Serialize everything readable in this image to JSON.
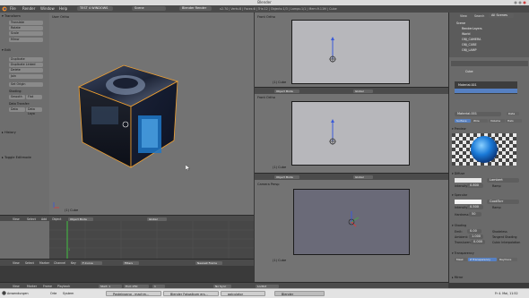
{
  "window": {
    "title": "Blender"
  },
  "info_header": {
    "menus": [
      "File",
      "Render",
      "Window",
      "Help"
    ],
    "screen_field": "TEST 4 WINDOWS",
    "scene_field": "Scene",
    "engine_field": "Blender Render",
    "stats": "v2.70 | Verts:8 | Faces:6 | Tris:12 | Objects:1/3 | Lamps:1/1 | Mem:9.11M | Cube"
  },
  "tool_panel": {
    "transform_header": "▾ Transform",
    "transform_buttons": [
      "Translate",
      "Rotate",
      "Scale",
      "Mirror"
    ],
    "edit_header": "▾ Edit",
    "edit_buttons": [
      "Duplicate",
      "Duplicate Linked",
      "Delete",
      "Join"
    ],
    "set_origin": "Set Origin",
    "shading_label": "Shading:",
    "shading_buttons": [
      "Smooth",
      "Flat"
    ],
    "data_transfer_label": "Data Transfer:",
    "data_buttons": [
      "Data",
      "Data Layo"
    ],
    "history_header": "▸ History",
    "toggle_label": "▸ Toggle Editmode"
  },
  "viewports": {
    "main_label": "User Ortho",
    "main_object": "(1) Cube",
    "top_label": "Front Ortho",
    "top_object": "(1) Cube",
    "mid_label": "Front Ortho",
    "mid_object": "(1) Cube",
    "cam_label": "Camera Persp",
    "cam_object": "(1) Cube"
  },
  "view_header": {
    "menus": [
      "View",
      "Select",
      "Add",
      "Object"
    ],
    "mode": "Object Mode",
    "pivot": "Global"
  },
  "outliner": {
    "view_menu": "View",
    "search_menu": "Search",
    "scenes_field": "All Scenes",
    "items": [
      "Scene",
      "RenderLayers",
      "World",
      "OBJ_CAMERA",
      "OBJ_CUBE",
      "OBJ_LAMP"
    ]
  },
  "properties": {
    "object_name": "Cube",
    "material_slot": "Material.001",
    "material_field": "Material.001",
    "data_tag": "Data",
    "tabs": [
      "Surface",
      "Wire",
      "Volume",
      "Halo"
    ],
    "preview_header": "▾ Preview",
    "diffuse_header": "▾ Diffuse",
    "diffuse_shader": "Lambert",
    "diffuse_intensity_label": "Intensity:",
    "diffuse_intensity": "0.800",
    "ramp_label": "Ramp",
    "specular_header": "▾ Specular",
    "specular_shader": "CookTorr",
    "specular_intensity_label": "Intensity:",
    "specular_intensity": "0.500",
    "hardness_label": "Hardness:",
    "hardness": "50",
    "shading_header": "▾ Shading",
    "emit_label": "Emit:",
    "emit": "0.00",
    "ambient_label": "Ambient:",
    "ambient": "1.000",
    "translucency_label": "Translucen:",
    "translucency": "0.000",
    "shadeless_label": "Shadeless",
    "tangent_label": "Tangent Shading",
    "cubic_label": "Cubic Interpolation",
    "transparency_header": "▾ Transparency",
    "transparency_buttons": [
      "Mask",
      "Z Transparency",
      "Raytrace"
    ],
    "mirror_header": "▸ Mirror"
  },
  "timeline": {
    "menus": [
      "View",
      "Marker",
      "Frame",
      "Playback"
    ],
    "start": "Start: 1",
    "end": "End: 250",
    "current": "1",
    "sync": "No Sync",
    "keying": "LocRot",
    "frame_marker": "1"
  },
  "graph_header": {
    "menus": [
      "View",
      "Select",
      "Marker",
      "Channel",
      "Key"
    ],
    "mode": "F-Curve",
    "filter": "Filters",
    "interp": "Nearest Frame"
  },
  "taskbar": {
    "menus": [
      "Anwendungen",
      "Orte",
      "System"
    ],
    "tasks": [
      "Posteingang - machm...",
      "Blender Fotoalbum ers...",
      "galculator",
      "Blender"
    ],
    "clock": "Fr 4. Mai, 11:52"
  },
  "colors": {
    "accent": "#5680c2",
    "selected_orange": "#f0a030",
    "x_axis": "#d83c3c",
    "y_axis": "#4aa74a",
    "z_axis": "#3a5ad8"
  }
}
